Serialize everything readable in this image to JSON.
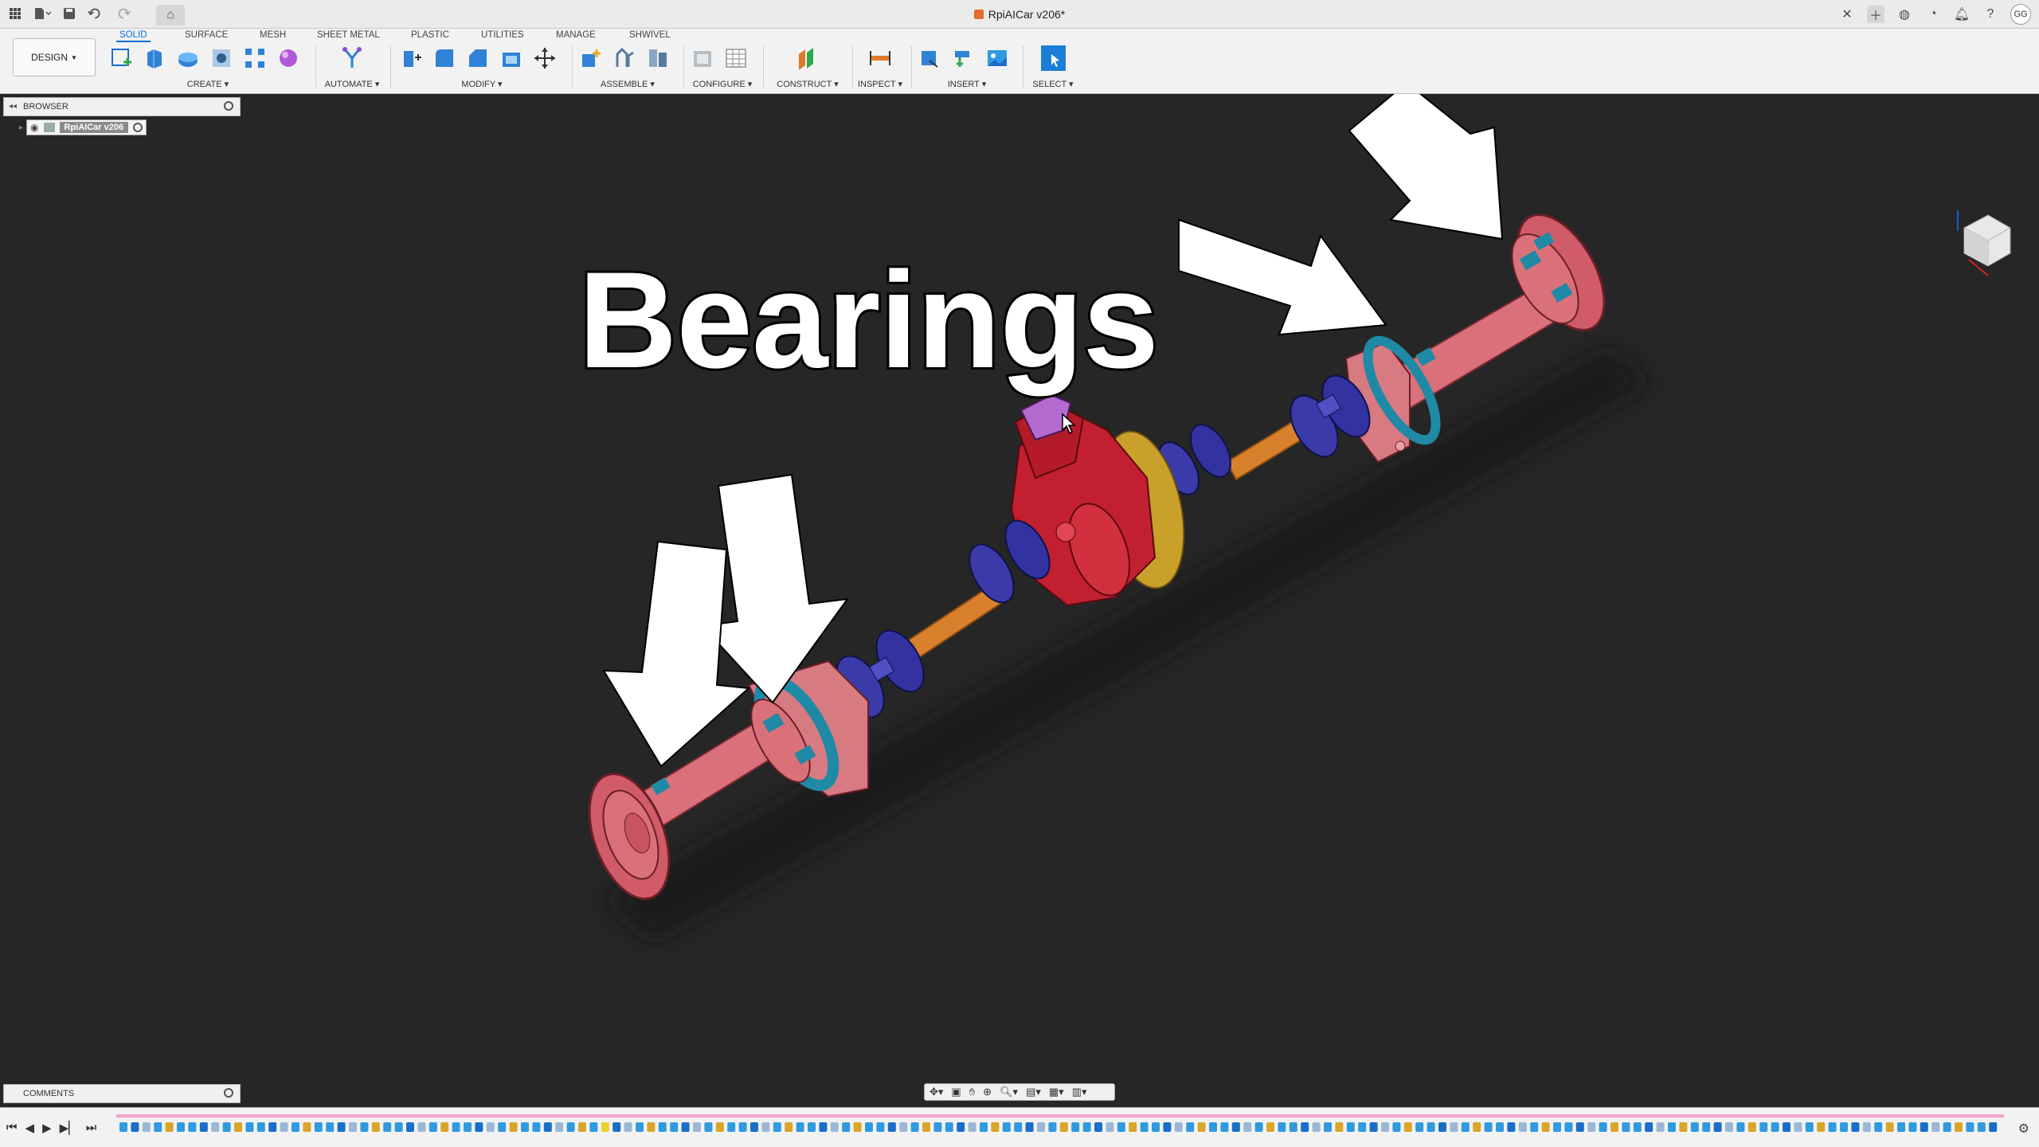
{
  "titlebar": {
    "document_title": "RpiAICar v206*",
    "user_initials": "GG"
  },
  "toolbar": {
    "workspace": "DESIGN",
    "tabs": [
      "SOLID",
      "SURFACE",
      "MESH",
      "SHEET METAL",
      "PLASTIC",
      "UTILITIES",
      "MANAGE",
      "SHWIVEL"
    ],
    "groups": [
      "CREATE",
      "AUTOMATE",
      "MODIFY",
      "ASSEMBLE",
      "CONFIGURE",
      "CONSTRUCT",
      "INSPECT",
      "INSERT",
      "SELECT"
    ]
  },
  "browser": {
    "title": "BROWSER",
    "root_node": "RpiAICar v206"
  },
  "annotation": {
    "label": "Bearings"
  },
  "comments": {
    "title": "COMMENTS"
  },
  "colors": {
    "viewport_bg": "#262626",
    "housing": "#d9707a",
    "bearing": "#1e8aa6",
    "ujoint": "#3a3aa8",
    "shaft": "#d9802c",
    "differential": "#c22030",
    "ring_gear": "#c9a12a",
    "accent": "#0a6fd6"
  }
}
